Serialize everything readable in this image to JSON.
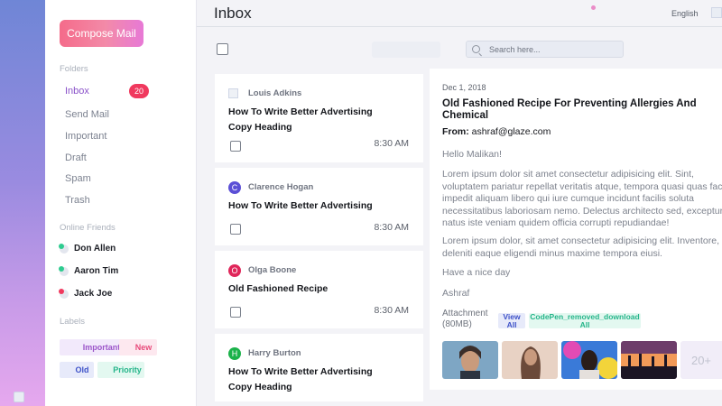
{
  "app": {
    "title": "Inbox",
    "language": "English"
  },
  "sidebar": {
    "compose_label": "Compose Mail",
    "folders_title": "Folders",
    "folders": [
      {
        "label": "Inbox",
        "active": true,
        "count": "20"
      },
      {
        "label": "Send Mail"
      },
      {
        "label": "Important"
      },
      {
        "label": "Draft"
      },
      {
        "label": "Spam"
      },
      {
        "label": "Trash"
      }
    ],
    "friends_title": "Online Friends",
    "friends": [
      {
        "name": "Don Allen",
        "status_color": "#2ecc8f"
      },
      {
        "name": "Aaron Tim",
        "status_color": "#2ecc8f"
      },
      {
        "name": "Jack Joe",
        "status_color": "#f0395e"
      }
    ],
    "labels_title": "Labels",
    "labels": [
      {
        "label": "Important",
        "color": "#9b55c9",
        "bg": "#f2e9fb"
      },
      {
        "label": "New",
        "color": "#e84a7a",
        "bg": "#fde8ef"
      },
      {
        "label": "Old",
        "color": "#3d51c8",
        "bg": "#e7eafa"
      },
      {
        "label": "Priority",
        "color": "#25b58a",
        "bg": "#e3f8f0"
      }
    ]
  },
  "toolbar": {
    "search_placeholder": "Search here..."
  },
  "mails": [
    {
      "avatar": "",
      "avatar_color": "",
      "sender": "Louis Adkins",
      "subject": "How To Write Better Advertising Copy Heading",
      "time": "8:30 AM"
    },
    {
      "avatar": "C",
      "avatar_color": "#5b4fd6",
      "sender": "Clarence Hogan",
      "subject": "How To Write Better Advertising",
      "time": "8:30 AM"
    },
    {
      "avatar": "O",
      "avatar_color": "#e0265a",
      "sender": "Olga Boone",
      "subject": "Old Fashioned Recipe",
      "time": "8:30 AM"
    },
    {
      "avatar": "H",
      "avatar_color": "#1bb24a",
      "sender": "Harry Burton",
      "subject": "How To Write Better Advertising Copy Heading",
      "time": ""
    }
  ],
  "reader": {
    "date": "Dec 1, 2018",
    "title": "Old Fashioned Recipe For Preventing Allergies And Chemical",
    "from_label": "From:",
    "from_email": "ashraf@glaze.com",
    "greeting": "Hello Malikan!",
    "para1": "Lorem ipsum dolor sit amet consectetur adipisicing elit. Sint, voluptatem pariatur repellat veritatis atque, tempora quasi quas facere impedit aliquam libero qui iure cumque incidunt facilis soluta necessitatibus laboriosam nemo. Delectus architecto sed, excepturi natus iste veniam quidem officia corrupti repudiandae!",
    "para2": "Lorem ipsum dolor, sit amet consectetur adipisicing elit. Inventore, deleniti eaque eligendi minus maxime tempora eiusi.",
    "closing": "Have a nice day",
    "signature": "Ashraf",
    "attachment_label": "Attachment (80MB)",
    "view_all_label": "View All",
    "download_label": "CodePen_removed_download All",
    "more_label": "20+",
    "thumbnails": [
      {
        "name": "woman-portrait-thumbnail",
        "colors": [
          "#7ea6c4",
          "#c99b7c",
          "#3b2e2a"
        ]
      },
      {
        "name": "woman-hair-thumbnail",
        "colors": [
          "#e8d2c4",
          "#c89a7e",
          "#6b4a3a"
        ]
      },
      {
        "name": "man-graffiti-thumbnail",
        "colors": [
          "#e24bb4",
          "#3a7ad8",
          "#2a1d1a"
        ]
      },
      {
        "name": "sunset-silhouettes-thumbnail",
        "colors": [
          "#f29a58",
          "#6d3d6a",
          "#1b1524"
        ]
      }
    ]
  }
}
